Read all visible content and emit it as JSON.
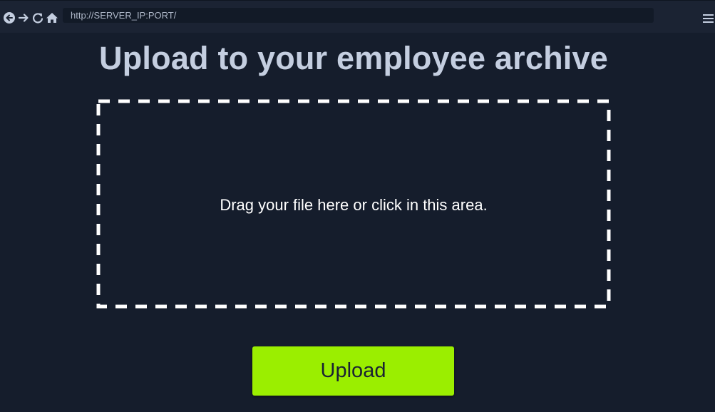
{
  "browser": {
    "url": "http://SERVER_IP:PORT/",
    "nav_icons": [
      "back-icon",
      "forward-icon",
      "reload-icon",
      "home-icon"
    ],
    "menu_icon": "menu-icon"
  },
  "page": {
    "title": "Upload to your employee archive",
    "drop_zone_text": "Drag your file here or click in this area.",
    "upload_label": "Upload"
  },
  "colors": {
    "background": "#151d2c",
    "title": "#c4cee0",
    "button": "#9bee00",
    "button_text": "#1a2233",
    "drop_border": "#ffffff"
  }
}
